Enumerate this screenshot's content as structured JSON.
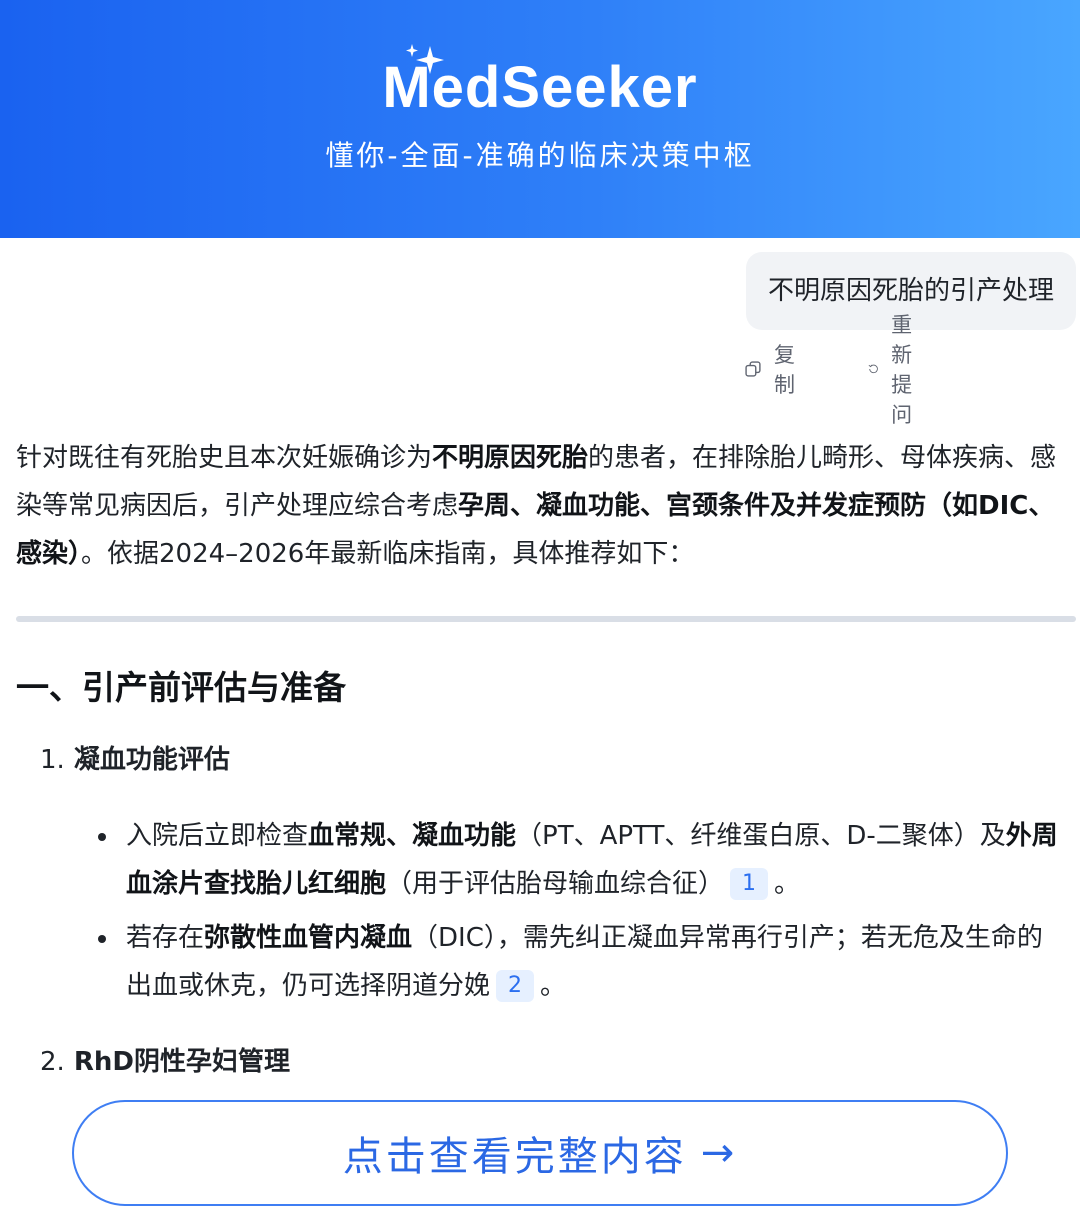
{
  "header": {
    "brand": "MedSeeker",
    "tagline": "懂你-全面-准确的临床决策中枢"
  },
  "conversation": {
    "user_query": "不明原因死胎的引产处理",
    "actions": {
      "copy_label": "复制",
      "retry_label": "重新提问"
    }
  },
  "answer": {
    "intro_parts": [
      "针对既往有死胎史且本次妊娠确诊为",
      "不明原因死胎",
      "的患者，在排除胎儿畸形、母体疾病、感染等常见病因后，引产处理应综合考虑",
      "孕周、凝血功能、宫颈条件及并发症预防（如DIC、感染）",
      "。依据2024–2026年最新临床指南，具体推荐如下："
    ],
    "section_title": "一、引产前评估与准备",
    "items": [
      {
        "num": "1.",
        "title": "凝血功能评估"
      },
      {
        "num": "2.",
        "title": "RhD阴性孕妇管理"
      }
    ],
    "bullets": [
      {
        "parts": [
          "入院后立即检查",
          "血常规、凝血功能",
          "（PT、APTT、纤维蛋白原、D-二聚体）及",
          "外周血涂片查找胎儿红细胞",
          "（用于评估胎母输血综合征）"
        ],
        "cite": "1",
        "end": "。"
      },
      {
        "parts": [
          "若存在",
          "弥散性血管内凝血",
          "（DIC），需先纠正凝血异常再行引产；若无危及生命的出血或休克，仍可选择阴道分娩"
        ],
        "cite": "2",
        "end": "。"
      }
    ]
  },
  "cta": {
    "label": "点击查看完整内容",
    "arrow": "→"
  },
  "colors": {
    "header_start": "#1a62f0",
    "header_end": "#49a6ff",
    "accent": "#2b68e4",
    "cite_bg": "#e6f0ff"
  },
  "icons": {
    "brand_spark": "sparkle-icon",
    "copy": "copy-icon",
    "retry": "refresh-icon",
    "cta_arrow": "arrow-right-icon"
  }
}
